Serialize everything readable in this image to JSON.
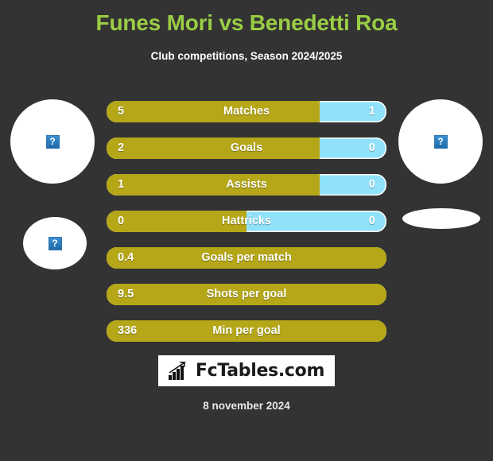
{
  "header": {
    "title": "Funes Mori vs Benedetti Roa",
    "subtitle": "Club competitions, Season 2024/2025",
    "title_color": "#9ACD44"
  },
  "theme": {
    "background": "#333333",
    "home_color": "#B5A717",
    "away_color": "#8FE2FA",
    "text_color": "#ffffff"
  },
  "players": {
    "home": {
      "name": "Funes Mori",
      "photo_placeholder": "broken-image",
      "photo_alt_glyph": "?"
    },
    "away": {
      "name": "Benedetti Roa",
      "photo_placeholder": "broken-image",
      "photo_alt_glyph": "?"
    }
  },
  "chart_data": {
    "type": "bar",
    "title": "Funes Mori vs Benedetti Roa",
    "subtitle": "Club competitions, Season 2024/2025",
    "orientation": "horizontal-diverging",
    "series": [
      {
        "name": "Funes Mori",
        "color": "#B5A717",
        "values": [
          5,
          2,
          1,
          0,
          0.4,
          9.5,
          336
        ]
      },
      {
        "name": "Benedetti Roa",
        "color": "#8FE2FA",
        "values": [
          1,
          0,
          0,
          0,
          null,
          null,
          null
        ]
      }
    ],
    "categories": [
      "Matches",
      "Goals",
      "Assists",
      "Hattricks",
      "Goals per match",
      "Shots per goal",
      "Min per goal"
    ],
    "legend": [
      "Funes Mori",
      "Benedetti Roa"
    ],
    "grid": false
  },
  "stats": [
    {
      "label": "Matches",
      "home": "5",
      "away": "1",
      "home_pct": 76,
      "has_away": true
    },
    {
      "label": "Goals",
      "home": "2",
      "away": "0",
      "home_pct": 76,
      "has_away": true
    },
    {
      "label": "Assists",
      "home": "1",
      "away": "0",
      "home_pct": 76,
      "has_away": true
    },
    {
      "label": "Hattricks",
      "home": "0",
      "away": "0",
      "home_pct": 50,
      "has_away": true
    },
    {
      "label": "Goals per match",
      "home": "0.4",
      "away": "",
      "home_pct": 100,
      "has_away": false
    },
    {
      "label": "Shots per goal",
      "home": "9.5",
      "away": "",
      "home_pct": 100,
      "has_away": false
    },
    {
      "label": "Min per goal",
      "home": "336",
      "away": "",
      "home_pct": 100,
      "has_away": false
    }
  ],
  "footer": {
    "logo_text": "FcTables.com",
    "logo_icon": "bar-chart-arrow-icon",
    "date": "8 november 2024"
  }
}
